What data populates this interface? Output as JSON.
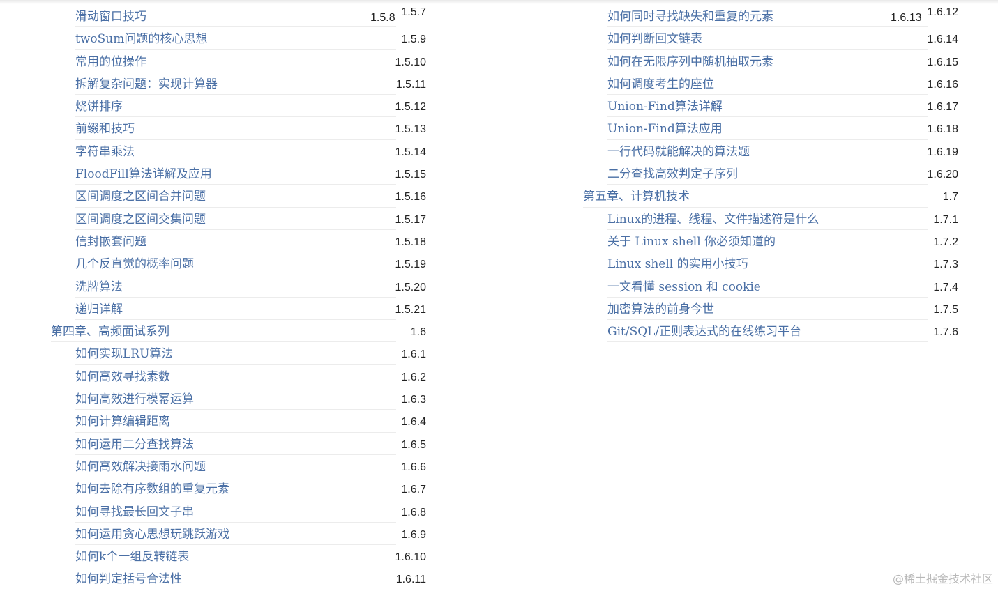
{
  "left_column": [
    {
      "title": "滑动窗口技巧",
      "extra": "1.5.8",
      "num": "1.5.7",
      "level": "sub"
    },
    {
      "title": "twoSum问题的核心思想",
      "num": "1.5.9",
      "level": "sub"
    },
    {
      "title": "常用的位操作",
      "num": "1.5.10",
      "level": "sub"
    },
    {
      "title": "拆解复杂问题：实现计算器",
      "num": "1.5.11",
      "level": "sub"
    },
    {
      "title": "烧饼排序",
      "num": "1.5.12",
      "level": "sub"
    },
    {
      "title": "前缀和技巧",
      "num": "1.5.13",
      "level": "sub"
    },
    {
      "title": "字符串乘法",
      "num": "1.5.14",
      "level": "sub"
    },
    {
      "title": "FloodFill算法详解及应用",
      "num": "1.5.15",
      "level": "sub"
    },
    {
      "title": "区间调度之区间合并问题",
      "num": "1.5.16",
      "level": "sub"
    },
    {
      "title": "区间调度之区间交集问题",
      "num": "1.5.17",
      "level": "sub"
    },
    {
      "title": "信封嵌套问题",
      "num": "1.5.18",
      "level": "sub"
    },
    {
      "title": "几个反直觉的概率问题",
      "num": "1.5.19",
      "level": "sub"
    },
    {
      "title": "洗牌算法",
      "num": "1.5.20",
      "level": "sub"
    },
    {
      "title": "递归详解",
      "num": "1.5.21",
      "level": "sub"
    },
    {
      "title": "第四章、高频面试系列",
      "num": "1.6",
      "level": "chapter"
    },
    {
      "title": "如何实现LRU算法",
      "num": "1.6.1",
      "level": "sub"
    },
    {
      "title": "如何高效寻找素数",
      "num": "1.6.2",
      "level": "sub"
    },
    {
      "title": "如何高效进行模幂运算",
      "num": "1.6.3",
      "level": "sub"
    },
    {
      "title": "如何计算编辑距离",
      "num": "1.6.4",
      "level": "sub"
    },
    {
      "title": "如何运用二分查找算法",
      "num": "1.6.5",
      "level": "sub"
    },
    {
      "title": "如何高效解决接雨水问题",
      "num": "1.6.6",
      "level": "sub"
    },
    {
      "title": "如何去除有序数组的重复元素",
      "num": "1.6.7",
      "level": "sub"
    },
    {
      "title": "如何寻找最长回文子串",
      "num": "1.6.8",
      "level": "sub"
    },
    {
      "title": "如何运用贪心思想玩跳跃游戏",
      "num": "1.6.9",
      "level": "sub"
    },
    {
      "title": "如何k个一组反转链表",
      "num": "1.6.10",
      "level": "sub"
    },
    {
      "title": "如何判定括号合法性",
      "num": "1.6.11",
      "level": "sub"
    }
  ],
  "right_column": [
    {
      "title": "如何同时寻找缺失和重复的元素",
      "extra": "1.6.13",
      "num": "1.6.12",
      "level": "sub"
    },
    {
      "title": "如何判断回文链表",
      "num": "1.6.14",
      "level": "sub"
    },
    {
      "title": "如何在无限序列中随机抽取元素",
      "num": "1.6.15",
      "level": "sub"
    },
    {
      "title": "如何调度考生的座位",
      "num": "1.6.16",
      "level": "sub"
    },
    {
      "title": "Union-Find算法详解",
      "num": "1.6.17",
      "level": "sub"
    },
    {
      "title": "Union-Find算法应用",
      "num": "1.6.18",
      "level": "sub"
    },
    {
      "title": "一行代码就能解决的算法题",
      "num": "1.6.19",
      "level": "sub"
    },
    {
      "title": "二分查找高效判定子序列",
      "num": "1.6.20",
      "level": "sub"
    },
    {
      "title": "第五章、计算机技术",
      "num": "1.7",
      "level": "chapter"
    },
    {
      "title": "Linux的进程、线程、文件描述符是什么",
      "num": "1.7.1",
      "level": "sub"
    },
    {
      "title": "关于 Linux shell 你必须知道的",
      "num": "1.7.2",
      "level": "sub"
    },
    {
      "title": "Linux shell 的实用小技巧",
      "num": "1.7.3",
      "level": "sub"
    },
    {
      "title": "一文看懂 session 和 cookie",
      "num": "1.7.4",
      "level": "sub"
    },
    {
      "title": "加密算法的前身今世",
      "num": "1.7.5",
      "level": "sub"
    },
    {
      "title": "Git/SQL/正则表达式的在线练习平台",
      "num": "1.7.6",
      "level": "sub"
    }
  ],
  "watermark": "@稀土掘金技术社区",
  "colors": {
    "link": "#4a6fa5",
    "number": "#222222",
    "rule": "#ececec",
    "divider": "#b4b4b4",
    "watermark": "#b8b8b8"
  }
}
